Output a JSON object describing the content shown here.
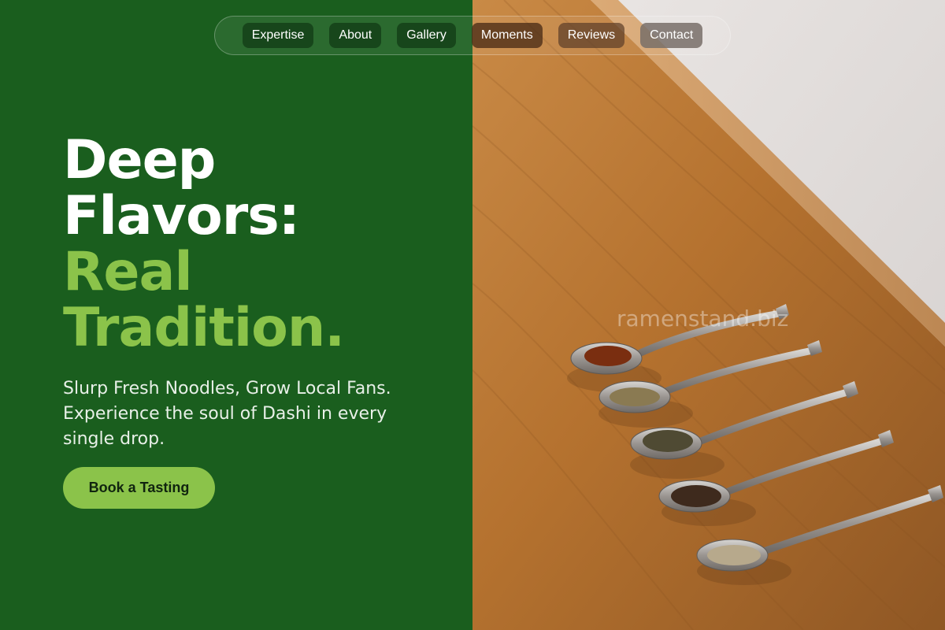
{
  "nav": {
    "items": [
      "Expertise",
      "About",
      "Gallery",
      "Moments",
      "Reviews",
      "Contact"
    ]
  },
  "hero": {
    "headline_white_1": "Deep",
    "headline_white_2": "Flavors:",
    "headline_green_1": "Real",
    "headline_green_2": "Tradition.",
    "subtext": "Slurp Fresh Noodles, Grow Local Fans. Experience the soul of Dashi in every single drop.",
    "cta_label": "Book a Tasting"
  },
  "photo": {
    "watermark": "ramenstand.biz",
    "description_icon": "spoons-with-tea-leaves-photo"
  },
  "colors": {
    "background_green": "#1a5e1e",
    "accent_green": "#8bc34a",
    "wood": "#b7783a"
  }
}
